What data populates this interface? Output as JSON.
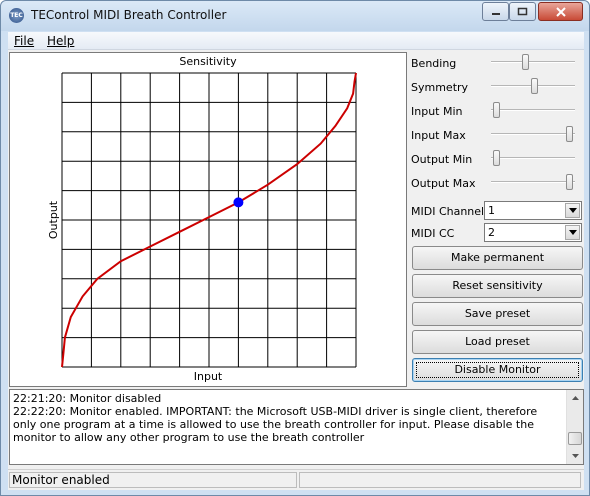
{
  "window": {
    "title": "TEControl MIDI Breath Controller",
    "icon_text": "TEC"
  },
  "menu": {
    "file": "File",
    "help": "Help"
  },
  "chart_data": {
    "type": "line",
    "title": "Sensitivity",
    "xlabel": "Input",
    "ylabel": "Output",
    "xlim": [
      0,
      1
    ],
    "ylim": [
      0,
      1
    ],
    "grid": true,
    "grid_divisions": 10,
    "series": [
      {
        "color": "#cc0000",
        "x": [
          0.0,
          0.005,
          0.01,
          0.03,
          0.07,
          0.12,
          0.2,
          0.3,
          0.4,
          0.5,
          0.6,
          0.7,
          0.8,
          0.88,
          0.93,
          0.97,
          0.99,
          0.995,
          1.0
        ],
        "y": [
          0.0,
          0.05,
          0.1,
          0.17,
          0.24,
          0.3,
          0.36,
          0.41,
          0.46,
          0.51,
          0.56,
          0.62,
          0.69,
          0.76,
          0.82,
          0.88,
          0.93,
          0.97,
          1.0
        ]
      }
    ],
    "marker": {
      "x": 0.6,
      "y": 0.56,
      "color": "#0000ff"
    }
  },
  "controls": {
    "bending": {
      "label": "Bending",
      "level": 0.4
    },
    "symmetry": {
      "label": "Symmetry",
      "level": 0.52
    },
    "input_min": {
      "label": "Input Min",
      "level": 0.02
    },
    "input_max": {
      "label": "Input Max",
      "level": 0.98
    },
    "output_min": {
      "label": "Output Min",
      "level": 0.02
    },
    "output_max": {
      "label": "Output Max",
      "level": 0.98
    },
    "midi_channel": {
      "label": "MIDI Channel",
      "value": "1"
    },
    "midi_cc": {
      "label": "MIDI CC",
      "value": "2"
    }
  },
  "buttons": {
    "make_permanent": "Make permanent",
    "reset_sensitivity": "Reset sensitivity",
    "save_preset": "Save preset",
    "load_preset": "Load preset",
    "disable_monitor": "Disable Monitor"
  },
  "log": {
    "lines": [
      "22:21:20: Monitor disabled",
      "22:22:20: Monitor enabled. IMPORTANT: the Microsoft USB-MIDI driver is single client, therefore only one program at a time is allowed to use the breath controller for input. Please disable the monitor to allow any other program to use the breath controller"
    ]
  },
  "status": {
    "text": "Monitor enabled"
  }
}
